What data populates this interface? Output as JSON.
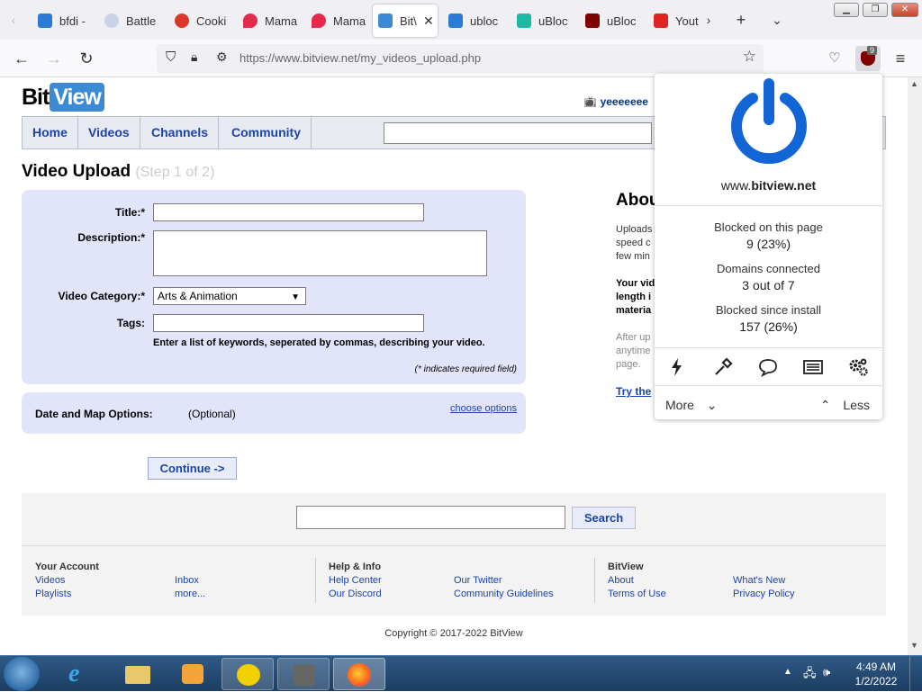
{
  "tabs": [
    {
      "label": "bfdi -"
    },
    {
      "label": "Battle"
    },
    {
      "label": "Cooki"
    },
    {
      "label": "Mama"
    },
    {
      "label": "Mama"
    },
    {
      "label": "Bit\\"
    },
    {
      "label": "ubloc"
    },
    {
      "label": "uBloc"
    },
    {
      "label": "uBloc"
    },
    {
      "label": "Yout"
    }
  ],
  "url": "https://www.bitview.net/my_videos_upload.php",
  "extension_badge": "9",
  "site": {
    "logo_bit": "Bit",
    "logo_view": "View",
    "user": "yeeeeeee",
    "nav": [
      "Home",
      "Videos",
      "Channels",
      "Community"
    ],
    "page_title": "Video Upload",
    "page_step": "(Step 1 of 2)",
    "form": {
      "title_label": "Title:*",
      "description_label": "Description:*",
      "category_label": "Video Category:*",
      "category_value": "Arts & Animation",
      "tags_label": "Tags:",
      "tags_help": "Enter a list of keywords, seperated by commas, describing your video.",
      "required_note": "(* indicates required field)"
    },
    "date_map": {
      "label": "Date and Map Options:",
      "optional": "(Optional)",
      "link": "choose options"
    },
    "continue": "Continue ->",
    "about": {
      "title": "Abou",
      "p1": [
        "Uploads",
        "speed c",
        "few min"
      ],
      "p2": [
        "Your vid",
        "length i",
        "materia"
      ],
      "p3": [
        "After up",
        "anytime",
        "page."
      ],
      "link": "Try the"
    },
    "footer": {
      "search_button": "Search",
      "col1_title": "Your Account",
      "col1_links": [
        "Videos",
        "Playlists",
        "Inbox",
        "more..."
      ],
      "col2_title": "Help & Info",
      "col2_links": [
        "Help Center",
        "Our Discord",
        "Our Twitter",
        "Community Guidelines"
      ],
      "col3_title": "BitView",
      "col3_links": [
        "About",
        "Terms of Use",
        "What's New",
        "Privacy Policy"
      ],
      "copyright": "Copyright © 2017-2022 BitView"
    }
  },
  "ublock": {
    "domain_plain": "www.",
    "domain_bold": "bitview.net",
    "blocked_page_label": "Blocked on this page",
    "blocked_page_value": "9 (23%)",
    "domains_label": "Domains connected",
    "domains_value": "3 out of 7",
    "install_label": "Blocked since install",
    "install_value": "157 (26%)",
    "more": "More",
    "less": "Less"
  },
  "taskbar": {
    "time": "4:49 AM",
    "date": "1/2/2022"
  }
}
